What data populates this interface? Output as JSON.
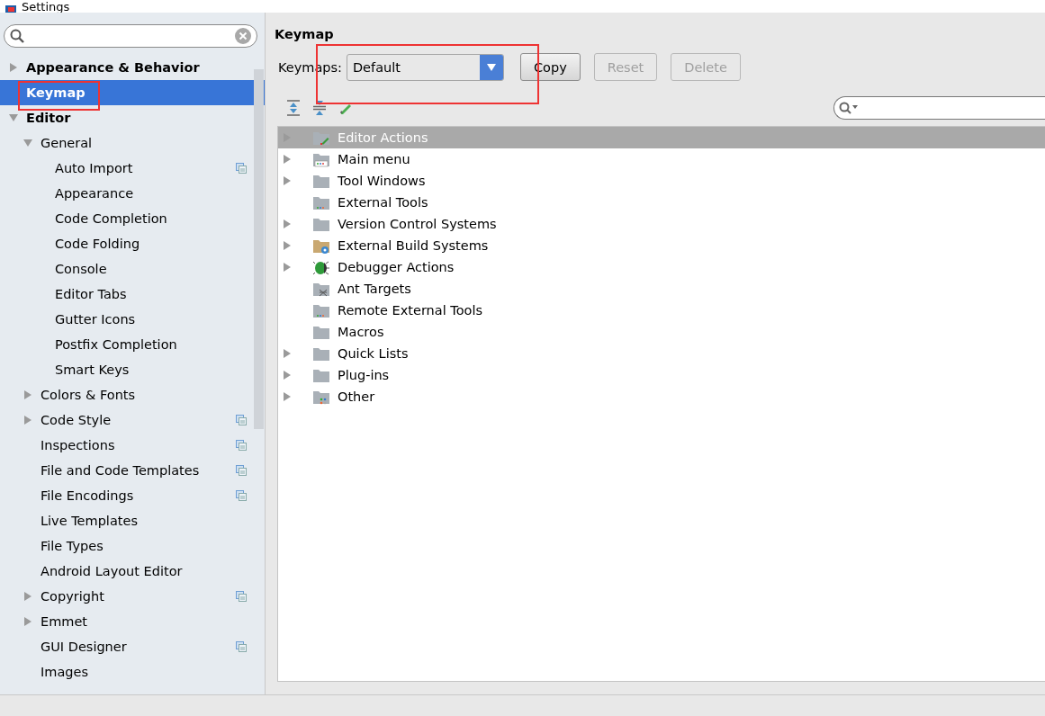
{
  "window": {
    "title": "Settings"
  },
  "sidebar": {
    "items": [
      {
        "label": "Appearance & Behavior",
        "expanded": false,
        "selected": false,
        "project": false
      },
      {
        "label": "Keymap",
        "selected": true,
        "project": false
      },
      {
        "label": "Editor",
        "expanded": true,
        "selected": false,
        "project": false,
        "children": [
          {
            "label": "General",
            "expanded": true,
            "selected": false,
            "project": false,
            "children": [
              {
                "label": "Auto Import",
                "selected": false,
                "project": true
              },
              {
                "label": "Appearance",
                "selected": false,
                "project": false
              },
              {
                "label": "Code Completion",
                "selected": false,
                "project": false
              },
              {
                "label": "Code Folding",
                "selected": false,
                "project": false
              },
              {
                "label": "Console",
                "selected": false,
                "project": false
              },
              {
                "label": "Editor Tabs",
                "selected": false,
                "project": false
              },
              {
                "label": "Gutter Icons",
                "selected": false,
                "project": false
              },
              {
                "label": "Postfix Completion",
                "selected": false,
                "project": false
              },
              {
                "label": "Smart Keys",
                "selected": false,
                "project": false
              }
            ]
          },
          {
            "label": "Colors & Fonts",
            "expanded": false,
            "selected": false,
            "project": false
          },
          {
            "label": "Code Style",
            "expanded": false,
            "selected": false,
            "project": true
          },
          {
            "label": "Inspections",
            "selected": false,
            "project": true
          },
          {
            "label": "File and Code Templates",
            "selected": false,
            "project": true
          },
          {
            "label": "File Encodings",
            "selected": false,
            "project": true
          },
          {
            "label": "Live Templates",
            "selected": false,
            "project": false
          },
          {
            "label": "File Types",
            "selected": false,
            "project": false
          },
          {
            "label": "Android Layout Editor",
            "selected": false,
            "project": false
          },
          {
            "label": "Copyright",
            "expanded": false,
            "selected": false,
            "project": true
          },
          {
            "label": "Emmet",
            "expanded": false,
            "selected": false,
            "project": false
          },
          {
            "label": "GUI Designer",
            "selected": false,
            "project": true
          },
          {
            "label": "Images",
            "selected": false,
            "project": false
          }
        ]
      }
    ]
  },
  "keymap": {
    "title": "Keymap",
    "label": "Keymaps:",
    "value": "Default",
    "buttons": [
      {
        "label": "Copy",
        "disabled": false
      },
      {
        "label": "Reset",
        "disabled": true
      },
      {
        "label": "Delete",
        "disabled": true
      }
    ],
    "actions": [
      {
        "label": "Editor Actions",
        "expandable": true,
        "selected": true,
        "kind": "editor"
      },
      {
        "label": "Main menu",
        "expandable": true,
        "selected": false,
        "kind": "menu"
      },
      {
        "label": "Tool Windows",
        "expandable": true,
        "selected": false,
        "kind": "folder"
      },
      {
        "label": "External Tools",
        "expandable": false,
        "selected": false,
        "kind": "tools"
      },
      {
        "label": "Version Control Systems",
        "expandable": true,
        "selected": false,
        "kind": "folder"
      },
      {
        "label": "External Build Systems",
        "expandable": true,
        "selected": false,
        "kind": "build"
      },
      {
        "label": "Debugger Actions",
        "expandable": true,
        "selected": false,
        "kind": "bug"
      },
      {
        "label": "Ant Targets",
        "expandable": false,
        "selected": false,
        "kind": "ant"
      },
      {
        "label": "Remote External Tools",
        "expandable": false,
        "selected": false,
        "kind": "tools"
      },
      {
        "label": "Macros",
        "expandable": false,
        "selected": false,
        "kind": "folder"
      },
      {
        "label": "Quick Lists",
        "expandable": true,
        "selected": false,
        "kind": "folder"
      },
      {
        "label": "Plug-ins",
        "expandable": true,
        "selected": false,
        "kind": "folder"
      },
      {
        "label": "Other",
        "expandable": true,
        "selected": false,
        "kind": "other"
      }
    ]
  }
}
